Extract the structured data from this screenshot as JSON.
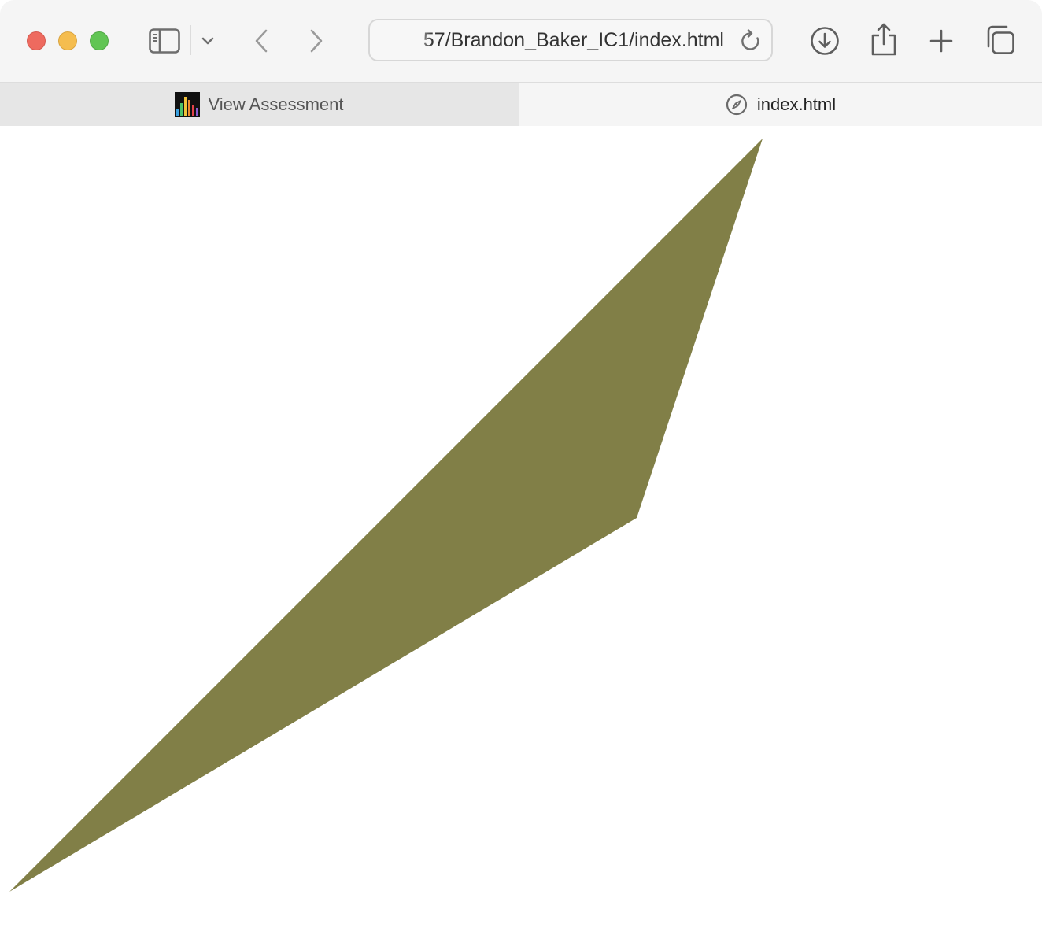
{
  "window": {
    "traffic_lights": {
      "close": "#ee6a5f",
      "minimize": "#f5bd4f",
      "maximize": "#61c554"
    }
  },
  "toolbar": {
    "icons": [
      "sidebar-icon",
      "chevron-down-icon",
      "back-icon",
      "forward-icon",
      "reload-icon",
      "download-icon",
      "share-icon",
      "plus-icon",
      "tabs-overview-icon"
    ],
    "address": {
      "text": "57/Brandon_Baker_IC1/index.html"
    }
  },
  "tabs": [
    {
      "label": "View Assessment",
      "icon": "bar-chart-favicon",
      "active": false
    },
    {
      "label": "index.html",
      "icon": "compass-icon",
      "active": true
    }
  ],
  "page": {
    "shape": {
      "type": "polygon",
      "fill": "#817f47"
    }
  }
}
